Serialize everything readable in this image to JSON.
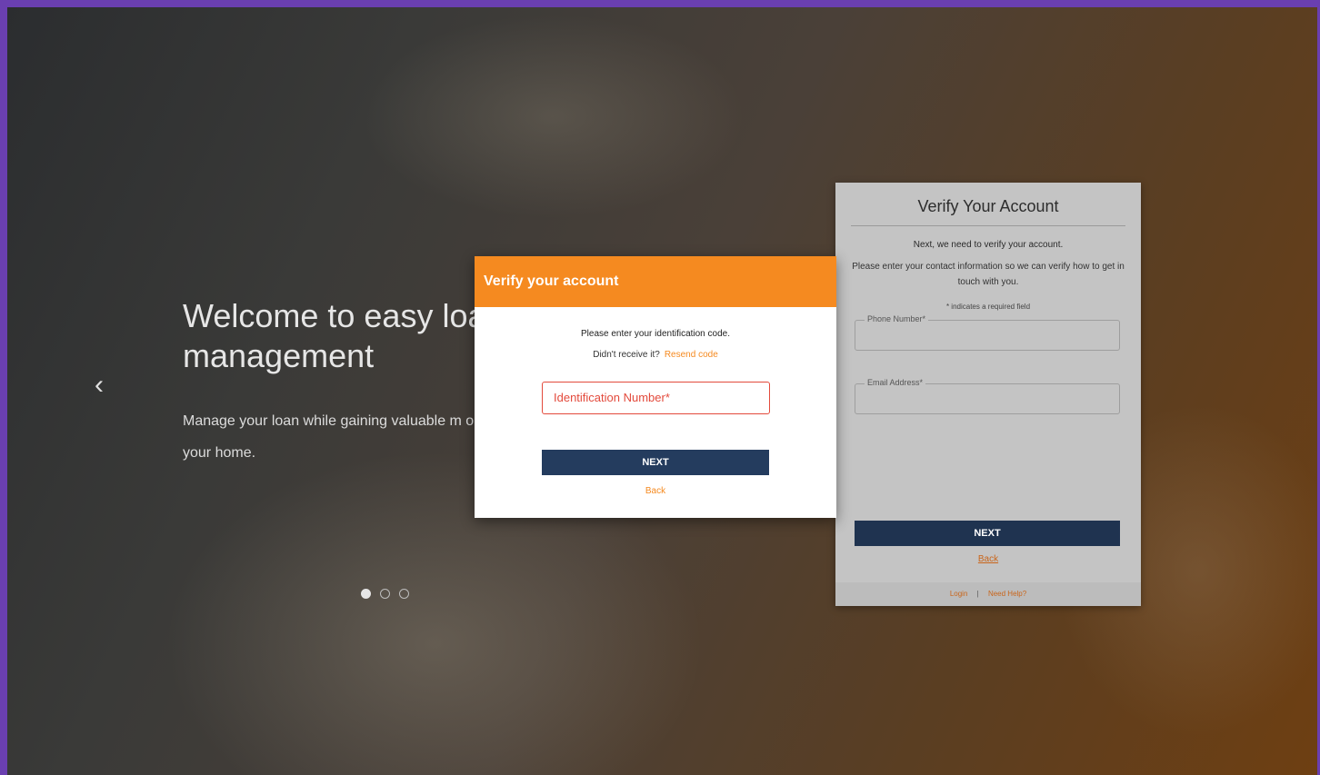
{
  "hero": {
    "title": "Welcome to easy loan management",
    "subtitle": "Manage your loan while gaining valuable m on your home.",
    "prev_icon": "chevron-left-icon",
    "carousel_dots": 3,
    "active_dot": 1
  },
  "background_form": {
    "title": "Verify Your Account",
    "intro": "Next, we need to verify your account.",
    "instructions": "Please enter your contact information so we can verify how to get in touch with you.",
    "required_note": "* indicates a required field",
    "phone_label": "Phone Number*",
    "email_label": "Email Address*",
    "next_label": "NEXT",
    "back_label": "Back",
    "footer_login": "Login",
    "footer_separator": "|",
    "footer_help": "Need Help?"
  },
  "modal": {
    "title": "Verify your account",
    "instruction": "Please enter your identification code.",
    "didnt_receive": "Didn't receive it?",
    "resend_label": "Resend code",
    "id_placeholder": "Identification Number*",
    "next_label": "NEXT",
    "back_label": "Back"
  },
  "colors": {
    "accent_orange": "#f58a20",
    "primary_navy": "#243c5e",
    "error_red": "#e34a3c",
    "frame_purple": "#6a3fb0"
  }
}
